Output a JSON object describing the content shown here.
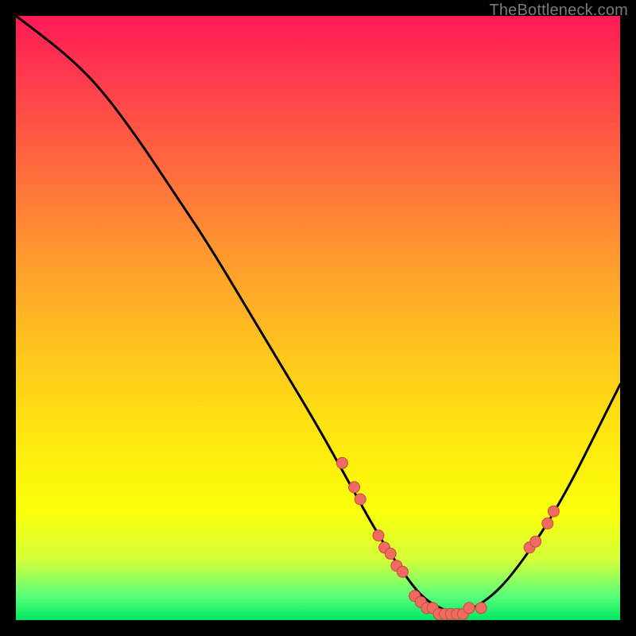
{
  "watermark": "TheBottleneck.com",
  "colors": {
    "point_fill": "#ef6b61",
    "point_stroke": "#c84a3e",
    "curve": "#000000"
  },
  "chart_data": {
    "type": "line",
    "title": "",
    "xlabel": "",
    "ylabel": "",
    "xlim": [
      0,
      100
    ],
    "ylim": [
      0,
      100
    ],
    "curve": {
      "x": [
        0,
        4,
        9,
        14,
        20,
        26,
        32,
        38,
        44,
        50,
        55,
        60,
        64,
        67,
        70,
        73,
        76,
        80,
        84,
        88,
        92,
        96,
        100
      ],
      "y": [
        100,
        97,
        93,
        88,
        80,
        71,
        62,
        52,
        42,
        32,
        23,
        14,
        8,
        4,
        2,
        1,
        2,
        5,
        10,
        16,
        23,
        31,
        39
      ]
    },
    "points": [
      {
        "x": 54,
        "y": 26
      },
      {
        "x": 56,
        "y": 22
      },
      {
        "x": 57,
        "y": 20
      },
      {
        "x": 60,
        "y": 14
      },
      {
        "x": 61,
        "y": 12
      },
      {
        "x": 62,
        "y": 11
      },
      {
        "x": 63,
        "y": 9
      },
      {
        "x": 64,
        "y": 8
      },
      {
        "x": 66,
        "y": 4
      },
      {
        "x": 67,
        "y": 3
      },
      {
        "x": 68,
        "y": 2
      },
      {
        "x": 69,
        "y": 2
      },
      {
        "x": 70,
        "y": 1
      },
      {
        "x": 71,
        "y": 1
      },
      {
        "x": 72,
        "y": 1
      },
      {
        "x": 73,
        "y": 1
      },
      {
        "x": 74,
        "y": 1
      },
      {
        "x": 75,
        "y": 2
      },
      {
        "x": 77,
        "y": 2
      },
      {
        "x": 85,
        "y": 12
      },
      {
        "x": 86,
        "y": 13
      },
      {
        "x": 88,
        "y": 16
      },
      {
        "x": 89,
        "y": 18
      }
    ]
  }
}
